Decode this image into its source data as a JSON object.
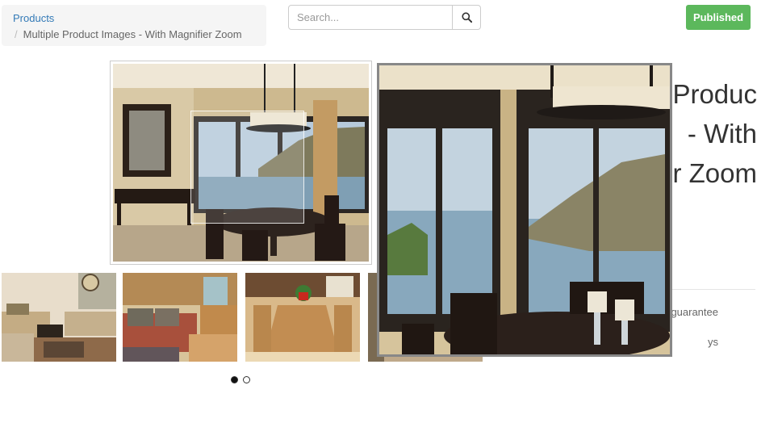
{
  "breadcrumb": {
    "link_label": "Products",
    "separator": "/",
    "current_label": "Multiple Product Images - With Magnifier Zoom"
  },
  "search": {
    "placeholder": "Search...",
    "button_icon": "search-icon"
  },
  "toolbar": {
    "published_label": "Published",
    "published_color": "#5cb85c"
  },
  "product": {
    "title": "Produc\n- With\nr Zoom",
    "info_lines": [
      "guarantee",
      "ys"
    ]
  },
  "gallery": {
    "thumbnails": [
      {
        "name": "living-room"
      },
      {
        "name": "sofa-room"
      },
      {
        "name": "dining-table"
      },
      {
        "name": "partial"
      }
    ],
    "dots": [
      {
        "active": true
      },
      {
        "active": false
      }
    ]
  },
  "colors": {
    "link": "#337ab7",
    "zoom_border": "#888888"
  }
}
